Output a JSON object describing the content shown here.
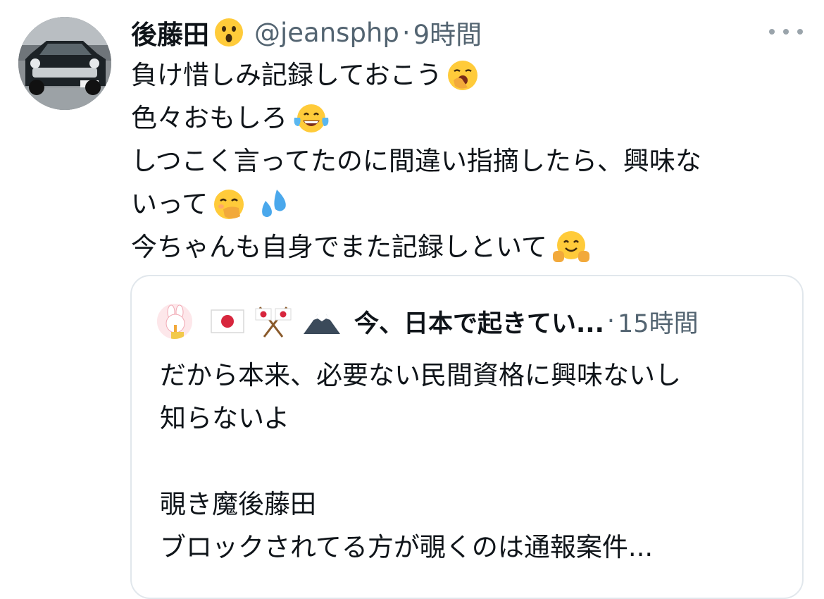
{
  "tweet": {
    "author": {
      "name": "後藤田",
      "name_emoji": "astonished-face-emoji",
      "handle": "@jeansphp",
      "separator": "·",
      "time": "9時間"
    },
    "more_icon": "ellipsis-icon",
    "lines": [
      {
        "text": "負け惜しみ記録しておこう",
        "emoji": [
          "yawning-face-emoji"
        ]
      },
      {
        "text": "色々おもしろ",
        "emoji": [
          "tears-of-joy-emoji"
        ]
      },
      {
        "text": "しつこく言ってたのに間違い指摘したら、興味な",
        "emoji": []
      },
      {
        "text": "いって",
        "emoji": [
          "face-with-hand-over-mouth-emoji",
          "sweat-droplets-emoji"
        ]
      },
      {
        "text": "今ちゃんも自身でまた記録しといて",
        "emoji": [
          "hugging-face-emoji"
        ]
      }
    ]
  },
  "quote": {
    "author": {
      "emoji": [
        "japan-flag-emoji",
        "crossed-flags-emoji",
        "mount-fuji-emoji"
      ],
      "name": "今、日本で起きてい...",
      "separator": "·",
      "time": "15時間"
    },
    "lines": [
      "だから本来、必要ない民間資格に興味ないし",
      "知らないよ",
      "",
      "覗き魔後藤田",
      "ブロックされてる方が覗くのは通報案件..."
    ]
  },
  "colors": {
    "primary_text": "#0f1419",
    "secondary_text": "#536471",
    "border": "#e1e7ec",
    "background": "#ffffff"
  }
}
